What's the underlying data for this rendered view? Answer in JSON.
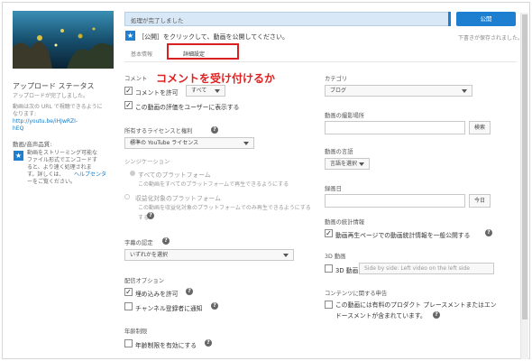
{
  "sidebar": {
    "upload_status_title": "アップロード ステータス",
    "upload_status_text": "アップロードが完了しました。",
    "url_note": "動画は次の URL で視聴できるように\nなります:",
    "video_url": "http://youtu.be/iHJwRZI-\nhEQ",
    "audio_section_title": "動画/音声品質:",
    "audio_note": "動画をストリーミング可能な\nファイル形式でエンコードす\nると、より速く処理されま\nす。詳しくは、",
    "help_center_link": "ヘルプセンタ",
    "audio_note_end": "ーをご覧ください。"
  },
  "top": {
    "status_message": "処理が完了しました",
    "publish_button": "公開",
    "instruction": "［公開］をクリックして、動画を公開してください。",
    "draft_saved": "下書きが保存されました。"
  },
  "tabs": [
    "基本情報",
    "詳細設定"
  ],
  "annotation": "コメントを受け付けるか",
  "left": {
    "comments_label": "コメント",
    "allow_comments": "コメントを許可",
    "comments_select": "すべて",
    "show_ratings": "この動画の評価をユーザーに表示する",
    "license_label": "所有するライセンスと権利",
    "license_select": "標準の YouTube ライセンス",
    "syndication_label": "シンジケーション",
    "syndication_all": "すべてのプラットフォーム",
    "syndication_all_sub": "この動画をすべてのプラットフォームで再生できるようにする",
    "syndication_monetized": "収益化対象のプラットフォーム",
    "syndication_monetized_sub": "この動画を収益化対象のプラットフォームでのみ再生できるようにする",
    "captions_label": "字幕の認定",
    "captions_select": "いずれかを選択",
    "distribution_label": "配信オプション",
    "allow_embedding": "埋め込みを許可",
    "notify_subscribers": "チャンネル登録者に通知",
    "age_label": "年齢制限",
    "age_restriction": "年齢制限を有効にする"
  },
  "right": {
    "category_label": "カテゴリ",
    "category_select": "ブログ",
    "location_label": "動画の撮影場所",
    "search_button": "検索",
    "language_label": "動画の言語",
    "language_select": "言語を選択",
    "date_label": "録画日",
    "today_button": "今日",
    "stats_label": "動画の統計情報",
    "stats_public": "動画再生ページでの動画統計情報を一般公開する",
    "video3d_label": "3D 動画",
    "video3d_checkbox": "3D 動画",
    "video3d_select": "Side by side: Left video on the left side",
    "content_label": "コンテンツに関する申告",
    "content_declaration": "この動画には有料のプロダクト プレースメントまたはエン\nドースメントが含まれています。"
  },
  "colors": {
    "accent": "#1e7fd1",
    "annotation": "#e02020"
  }
}
